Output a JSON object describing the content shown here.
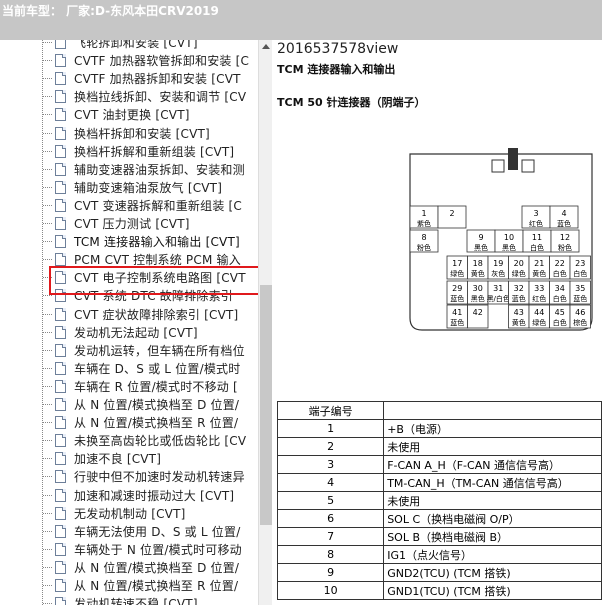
{
  "title_bar": {
    "text": "当前车型：  厂家:D-东风本田CRV2019"
  },
  "tree": {
    "items": [
      {
        "label": "飞轮拆卸和安装 [CVT]"
      },
      {
        "label": "CVTF 加热器软管拆卸和安装 [C"
      },
      {
        "label": "CVTF 加热器拆卸和安装 [CVT"
      },
      {
        "label": "换档拉线拆卸、安装和调节 [CV"
      },
      {
        "label": "CVT 油封更换 [CVT]"
      },
      {
        "label": "换档杆拆卸和安装 [CVT]"
      },
      {
        "label": "换档杆拆解和重新组装 [CVT]"
      },
      {
        "label": "辅助变速器油泵拆卸、安装和测"
      },
      {
        "label": "辅助变速箱油泵放气 [CVT]"
      },
      {
        "label": "CVT 变速器拆解和重新组装 [C"
      },
      {
        "label": "CVT 压力测试 [CVT]"
      },
      {
        "label": "TCM 连接器输入和输出 [CVT]",
        "selected": true
      },
      {
        "label": "PCM CVT 控制系统 PCM 输入"
      },
      {
        "label": "CVT 电子控制系统电路图 [CVT"
      },
      {
        "label": "CVT 系统 DTC 故障排除索引"
      },
      {
        "label": "CVT 症状故障排除索引 [CVT]"
      },
      {
        "label": "发动机无法起动 [CVT]"
      },
      {
        "label": "发动机运转，但车辆在所有档位"
      },
      {
        "label": "车辆在 D、S 或 L 位置/模式时"
      },
      {
        "label": "车辆在 R 位置/模式时不移动 ["
      },
      {
        "label": "从 N 位置/模式换档至 D 位置/"
      },
      {
        "label": "从 N 位置/模式换档至 R 位置/"
      },
      {
        "label": "未换至高齿轮比或低齿轮比 [CV"
      },
      {
        "label": "加速不良 [CVT]"
      },
      {
        "label": "行驶中但不加速时发动机转速异"
      },
      {
        "label": "加速和减速时振动过大 [CVT]"
      },
      {
        "label": "无发动机制动 [CVT]"
      },
      {
        "label": "车辆无法使用 D、S 或 L 位置/"
      },
      {
        "label": "车辆处于 N 位置/模式时可移动"
      },
      {
        "label": "从 N 位置/模式换档至 D 位置/"
      },
      {
        "label": "从 N 位置/模式换档至 R 位置/"
      },
      {
        "label": "发动机转速不稳 [CVT]"
      }
    ]
  },
  "document": {
    "doc_id": "2016537578view",
    "heading": "TCM 连接器输入和输出",
    "connector_title": "TCM 50 针连接器（阴端子）",
    "connector_pins": [
      {
        "n": "1",
        "c": "紫色"
      },
      {
        "n": "2",
        "c": ""
      },
      {
        "n": "3",
        "c": "红色"
      },
      {
        "n": "4",
        "c": "蓝色"
      },
      {
        "n": "8",
        "c": "粉色"
      },
      {
        "n": "9",
        "c": "黑色"
      },
      {
        "n": "10",
        "c": "黑色"
      },
      {
        "n": "11",
        "c": "白色"
      },
      {
        "n": "12",
        "c": "粉色"
      },
      {
        "n": "17",
        "c": "绿色"
      },
      {
        "n": "18",
        "c": "黄色"
      },
      {
        "n": "19",
        "c": "灰色"
      },
      {
        "n": "20",
        "c": "绿色"
      },
      {
        "n": "21",
        "c": "黄色"
      },
      {
        "n": "22",
        "c": "白色"
      },
      {
        "n": "23",
        "c": "白色"
      },
      {
        "n": "29",
        "c": "蓝色"
      },
      {
        "n": "30",
        "c": "黑色"
      },
      {
        "n": "31",
        "c": "黑/白色"
      },
      {
        "n": "32",
        "c": "蓝色"
      },
      {
        "n": "33",
        "c": "红色"
      },
      {
        "n": "34",
        "c": "白色"
      },
      {
        "n": "35",
        "c": "蓝色"
      },
      {
        "n": "41",
        "c": "蓝色"
      },
      {
        "n": "42",
        "c": ""
      },
      {
        "n": "43",
        "c": "黄色"
      },
      {
        "n": "44",
        "c": "绿色"
      },
      {
        "n": "45",
        "c": "白色"
      },
      {
        "n": "46",
        "c": "棕色"
      }
    ],
    "table": {
      "header": "端子编号",
      "rows": [
        {
          "num": "1",
          "desc": "+B（电源）"
        },
        {
          "num": "2",
          "desc": "未使用"
        },
        {
          "num": "3",
          "desc": "F-CAN A_H（F-CAN 通信信号高）"
        },
        {
          "num": "4",
          "desc": "TM-CAN_H（TM-CAN 通信信号高）"
        },
        {
          "num": "5",
          "desc": "未使用"
        },
        {
          "num": "6",
          "desc": "SOL C（换档电磁阀 O/P）"
        },
        {
          "num": "7",
          "desc": "SOL B（换档电磁阀 B）"
        },
        {
          "num": "8",
          "desc": "IG1（点火信号）"
        },
        {
          "num": "9",
          "desc": "GND2(TCU) (TCM 搭铁)"
        },
        {
          "num": "10",
          "desc": "GND1(TCU) (TCM 搭铁)"
        }
      ]
    }
  },
  "colors": {
    "title_bar_bg": "#c6c6c6",
    "selection_outline": "#e0191c"
  }
}
